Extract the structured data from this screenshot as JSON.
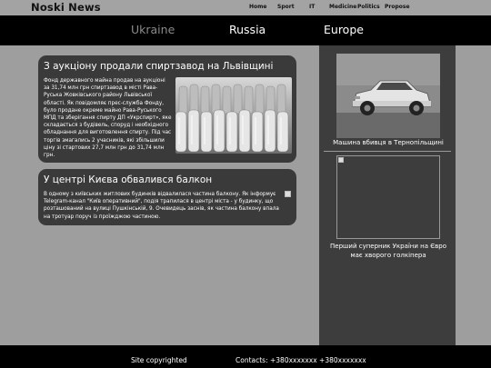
{
  "header": {
    "brand": "Noski News",
    "nav": [
      "Home",
      "Sport",
      "IT",
      "Medicine",
      "Politics",
      "Propose"
    ]
  },
  "regions": [
    "Ukraine",
    "Russia",
    "Europe"
  ],
  "articles": [
    {
      "title": "З аукціону продали спиртзавод на Львівщині",
      "text": "Фонд державного майна продав на аукціоні за 31,74 млн грн спиртзавод в місті Рава-Руська Жовківського району Львівської області. Як повідомляє прес-служба Фонду, було продане окреме майно Рава-Руського МПД та зберігання спирту ДП «Укрспирт», яке складається з будівель, споруд і необхідного обладнання для виготовлення спирту. Під час торгів змагались 2 учасників, які збільшили ціну зі стартових 27,7 млн грн до 31,74 млн грн."
    },
    {
      "title": "У центрі Києва обвалився балкон",
      "text": "В одному з київських житлових будинків відвалилася частина балкону. Як інформує Telegram-канал \"Київ оперативний\", подія трапилася в центрі міста - у будинку, що розташований на вулиці Пушкінській, 9. Очевидець заснів, як частина балкону впала на тротуар поруч із проїжджою частиною."
    }
  ],
  "sidebar": [
    {
      "caption": "Машина вбивця в Тернопільщині"
    },
    {
      "caption": "Перший суперник України на Євро має хворого голкіпера"
    }
  ],
  "footer": {
    "copyright": "Site copyrighted",
    "contacts": "Contacts: +380xxxxxxx +380xxxxxxx"
  },
  "colors": {
    "page_bg": "#9e9e9e",
    "header_bg": "#a3a3a3",
    "band_bg": "#000000",
    "card_bg": "#3a3a3a",
    "panel_bg": "#3d3d3d",
    "dim_region": "#8a8a8a"
  }
}
